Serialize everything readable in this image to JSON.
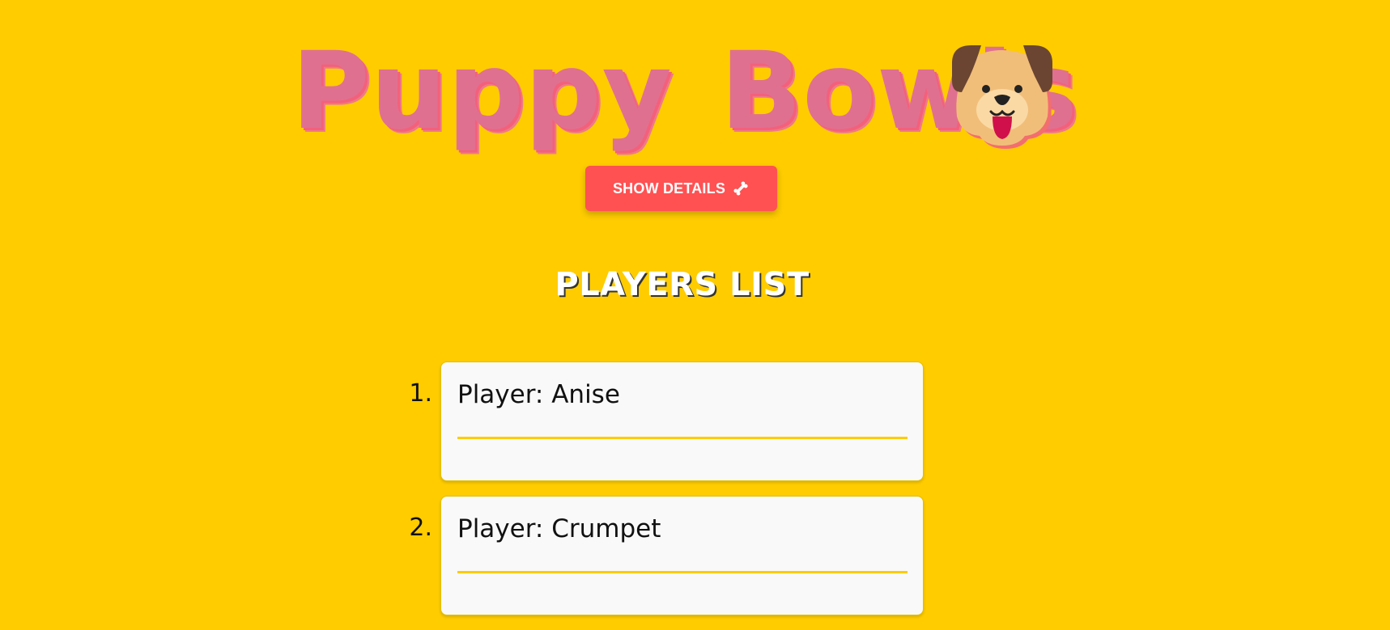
{
  "header": {
    "title": "Puppy Bowls",
    "logo_icon": "dog-face-icon"
  },
  "controls": {
    "show_details_label": "SHOW DETAILS",
    "show_details_icon": "bone-icon"
  },
  "players": {
    "heading": "PLAYERS LIST",
    "items": [
      {
        "number": "1.",
        "label": "Player: Anise"
      },
      {
        "number": "2.",
        "label": "Player: Crumpet"
      }
    ]
  },
  "colors": {
    "background": "#FFCC00",
    "title": "#E07090",
    "button": "#FF5152",
    "card": "#F9F9F9",
    "divider": "#FFCC00"
  }
}
